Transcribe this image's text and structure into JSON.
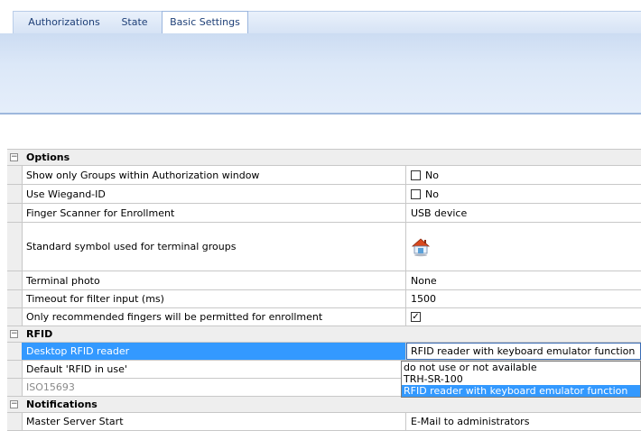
{
  "tabs": [
    "Authorizations",
    "State",
    "Basic Settings"
  ],
  "active_tab": "Basic Settings",
  "categories": {
    "options": "Options",
    "rfid": "RFID",
    "notifications": "Notifications"
  },
  "options": {
    "show_groups": {
      "label": "Show only Groups within Authorization window",
      "value": "No",
      "checked": false
    },
    "wiegand": {
      "label": "Use Wiegand-ID",
      "value": "No",
      "checked": false
    },
    "finger_scanner": {
      "label": "Finger Scanner for Enrollment",
      "value": "USB device"
    },
    "standard_symbol": {
      "label": "Standard symbol used for terminal groups",
      "icon": "house-terminal-icon"
    },
    "terminal_photo": {
      "label": "Terminal photo",
      "value": "None"
    },
    "timeout": {
      "label": "Timeout for filter input (ms)",
      "value": "1500"
    },
    "recommended_fingers": {
      "label": "Only recommended fingers will be permitted for enrollment",
      "checked": true
    }
  },
  "rfid": {
    "desktop_reader": {
      "label": "Desktop RFID reader",
      "value": "RFID reader with keyboard emulator function"
    },
    "default_rfid": {
      "label": "Default 'RFID in use'"
    },
    "iso": {
      "label": "ISO15693"
    }
  },
  "dropdown": {
    "options": [
      "do not use or not available",
      "TRH-SR-100",
      "RFID reader with keyboard emulator function"
    ],
    "selected_index": 2
  },
  "notifications": {
    "master_server_start": {
      "label": "Master Server Start",
      "value": "E-Mail to administrators"
    }
  },
  "colors": {
    "selection": "#3399ff",
    "tab_text": "#1e3f77",
    "band": "#dce8f8"
  }
}
